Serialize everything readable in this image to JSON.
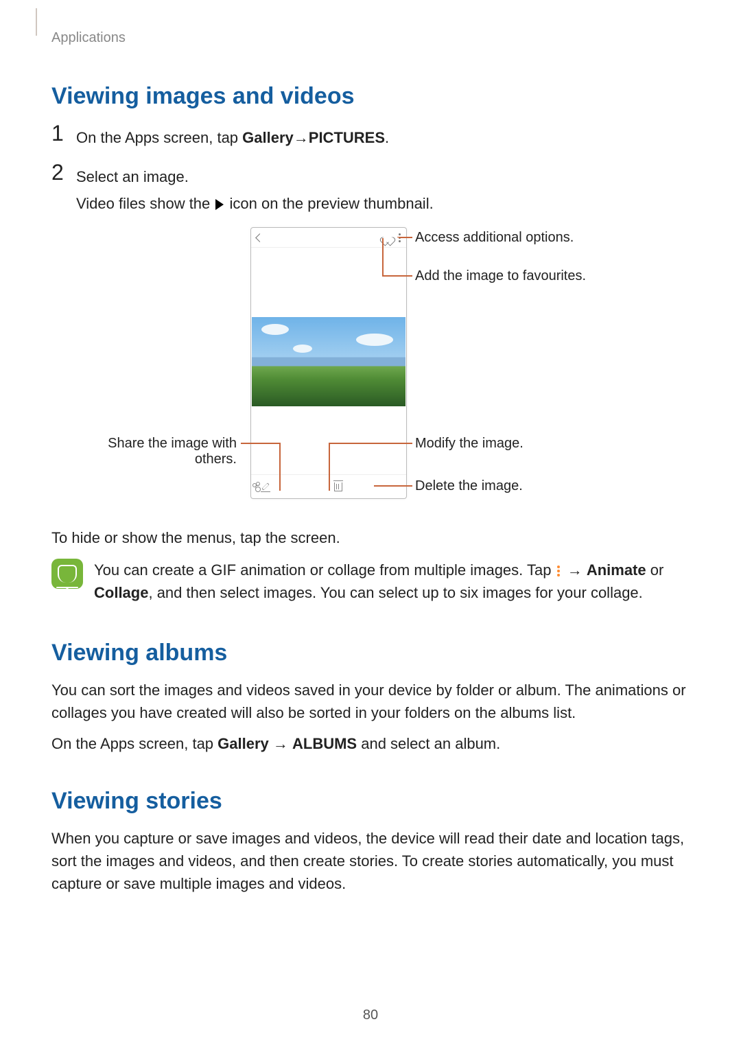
{
  "breadcrumb": "Applications",
  "heading1": "Viewing images and videos",
  "step1": {
    "num": "1",
    "text_lead": "On the Apps screen, tap ",
    "gallery": "Gallery",
    "arrow": " → ",
    "pictures": "PICTURES",
    "end": "."
  },
  "step2": {
    "num": "2",
    "line1": "Select an image.",
    "line2_a": "Video files show the ",
    "line2_b": " icon on the preview thumbnail."
  },
  "callouts": {
    "options": "Access additional options.",
    "favourites": "Add the image to favourites.",
    "share": "Share the image with others.",
    "modify": "Modify the image.",
    "delete": "Delete the image."
  },
  "hide_text": "To hide or show the menus, tap the screen.",
  "note": {
    "a": "You can create a GIF animation or collage from multiple images. Tap ",
    "arrow": " → ",
    "animate": "Animate",
    "or": " or ",
    "collage": "Collage",
    "b": ", and then select images. You can select up to six images for your collage."
  },
  "heading2": "Viewing albums",
  "albums_p1": "You can sort the images and videos saved in your device by folder or album. The animations or collages you have created will also be sorted in your folders on the albums list.",
  "albums_p2_a": "On the Apps screen, tap ",
  "albums_p2_gallery": "Gallery",
  "albums_p2_arrow": " → ",
  "albums_p2_albums": "ALBUMS",
  "albums_p2_b": " and select an album.",
  "heading3": "Viewing stories",
  "stories_p1": "When you capture or save images and videos, the device will read their date and location tags, sort the images and videos, and then create stories. To create stories automatically, you must capture or save multiple images and videos.",
  "page_num": "80"
}
